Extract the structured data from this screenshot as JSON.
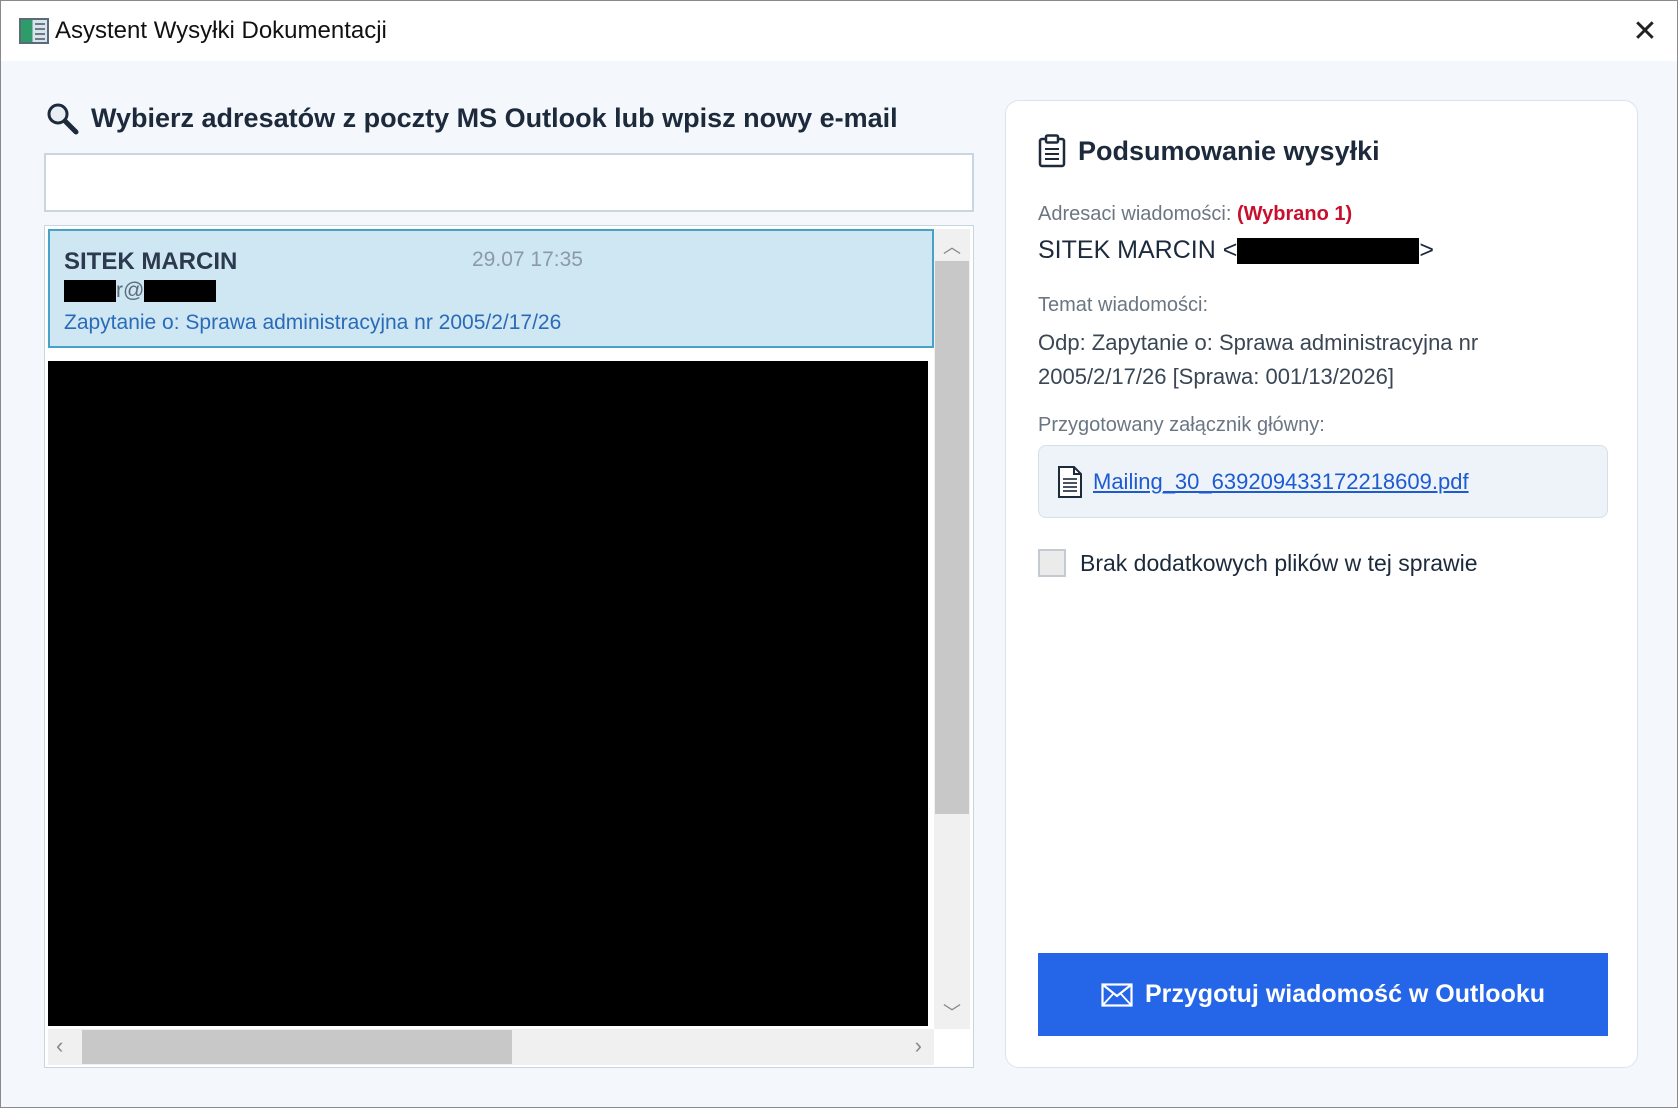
{
  "window": {
    "title": "Asystent Wysyłki Dokumentacji",
    "close_glyph": "✕"
  },
  "left": {
    "heading": "Wybierz adresatów z poczty MS Outlook lub wpisz nowy e-mail",
    "search": {
      "value": "",
      "placeholder": ""
    },
    "selected_item": {
      "name": "SITEK MARCIN",
      "date": "29.07 17:35",
      "email_visible": "r@",
      "subject": "Zapytanie o: Sprawa administracyjna nr 2005/2/17/26"
    }
  },
  "summary": {
    "title": "Podsumowanie wysyłki",
    "recipients_label": "Adresaci wiadomości:",
    "recipients_count": "(Wybrano 1)",
    "recipient_name": "SITEK MARCIN <",
    "recipient_close": ">",
    "subject_label": "Temat wiadomości:",
    "subject_value": "Odp: Zapytanie o: Sprawa administracyjna nr 2005/2/17/26 [Sprawa: 001/13/2026]",
    "attachment_label": "Przygotowany załącznik główny:",
    "attachment_file": "Mailing_30_639209433172218609.pdf",
    "no_files_label": "Brak dodatkowych plików w tej sprawie",
    "button_label": "Przygotuj wiadomość w Outlooku"
  },
  "icons": {
    "search": "magnifier-icon",
    "clipboard": "clipboard-icon",
    "document": "document-icon",
    "envelope": "envelope-icon"
  },
  "colors": {
    "accent_button": "#2566e8",
    "count_red": "#c8102e",
    "selection_bg": "#cfe6f3",
    "link": "#1c5bd1"
  }
}
